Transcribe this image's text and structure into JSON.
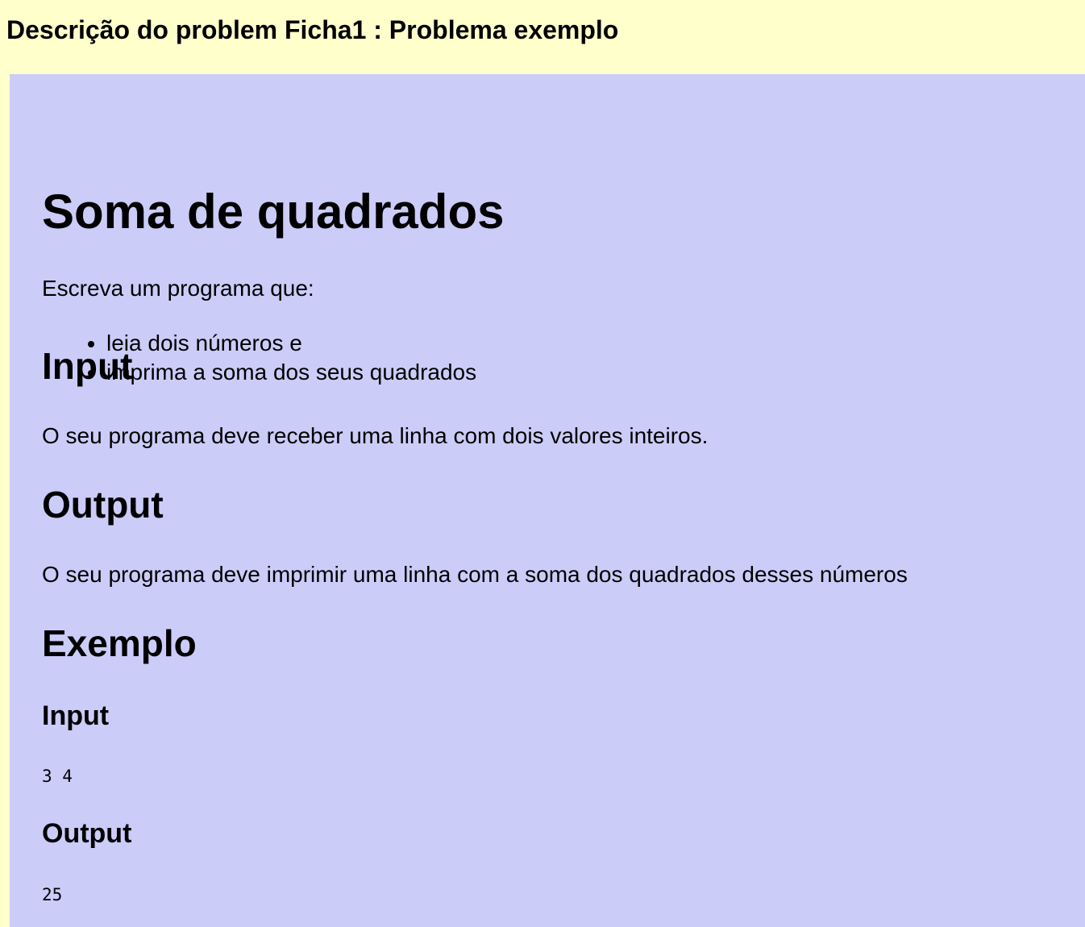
{
  "header": {
    "title": "Descrição do problem Ficha1 : Problema exemplo"
  },
  "problem": {
    "title": "Soma de quadrados",
    "intro": "Escreva um programa que:",
    "requirements": [
      "leia dois números e",
      "imprima a soma dos seus quadrados"
    ],
    "input_heading": "Input",
    "input_text": "O seu programa deve receber uma linha com dois valores inteiros.",
    "output_heading": "Output",
    "output_text": "O seu programa deve imprimir uma linha com a soma dos quadrados desses números",
    "example": {
      "heading": "Exemplo",
      "input_heading": "Input",
      "input_value": "3 4",
      "output_heading": "Output",
      "output_value": "25"
    }
  },
  "colors": {
    "page_background": "#ffffcc",
    "panel_background": "#ccccf9"
  }
}
